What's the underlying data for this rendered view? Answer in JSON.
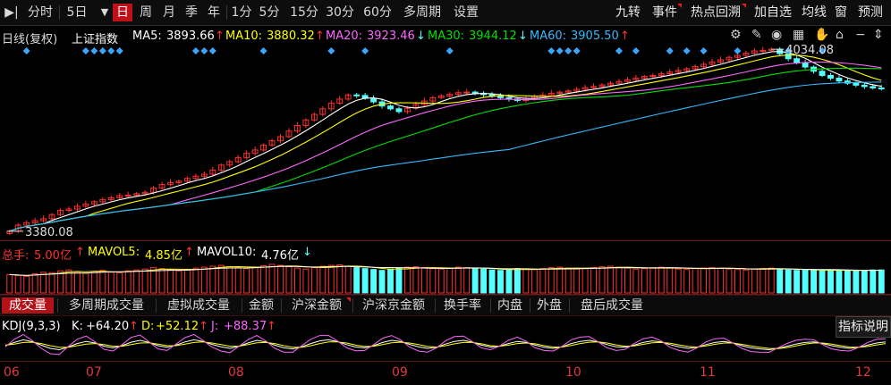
{
  "toolbar": {
    "left_icon": "▶︎|",
    "periods": [
      "分时",
      "5日",
      "日",
      "周",
      "月",
      "季",
      "年",
      "1分",
      "5分",
      "15分",
      "30分",
      "60分",
      "多周期",
      "设置"
    ],
    "active_period": "日",
    "dropdown_icon": "▼",
    "right": [
      "九转",
      "事件",
      "热点回溯",
      "加自选",
      "均线",
      "窗",
      "预测"
    ]
  },
  "legend": {
    "line_type": "日线(复权)",
    "index_name": "上证指数",
    "ma5_label": "MA5:",
    "ma5": "3893.66",
    "ma5_arrow": "↑",
    "ma10_label": "MA10:",
    "ma10": "3880.32",
    "ma10_arrow": "↑",
    "ma20_label": "MA20:",
    "ma20": "3923.46",
    "ma20_arrow": "↓",
    "ma30_label": "MA30:",
    "ma30": "3944.12",
    "ma30_arrow": "↓",
    "ma60_label": "MA60:",
    "ma60": "3905.50",
    "ma60_arrow": "↑"
  },
  "price_labels": {
    "high": "4034.08",
    "low": "3380.08"
  },
  "volume": {
    "total_label": "总手:",
    "total": "5.00亿",
    "total_arrow": "↑",
    "mavol5_label": "MAVOL5:",
    "mavol5": "4.85亿",
    "mavol5_arrow": "↑",
    "mavol10_label": "MAVOL10:",
    "mavol10": "4.76亿",
    "mavol10_arrow": "↓"
  },
  "indicator_tabs": [
    "成交量",
    "多周期成交量",
    "虚拟成交量",
    "金额",
    "沪深金额",
    "沪深京金额",
    "换手率",
    "内盘",
    "外盘",
    "盘后成交量"
  ],
  "active_tab": "成交量",
  "kdj": {
    "name": "KDJ(9,3,3)",
    "k_label": "K:",
    "k": "+64.20",
    "k_arrow": "↑",
    "d_label": "D:",
    "d": "+52.12",
    "d_arrow": "↑",
    "j_label": "J:",
    "j": "+88.37",
    "j_arrow": "↑"
  },
  "explain_button": "指标说明",
  "months": [
    "06",
    "07",
    "08",
    "09",
    "10",
    "11",
    "12"
  ],
  "colors": {
    "up": "#ff3030",
    "down": "#54ffff",
    "ma5": "#ffffff",
    "ma10": "#ffff00",
    "ma20": "#ff66ff",
    "ma30": "#00e000",
    "ma60": "#33bbff",
    "diamond": "#3aa6ff"
  },
  "chart_data": {
    "type": "candlestick",
    "y_range": [
      3380.08,
      4034.08
    ],
    "close": [
      3380,
      3402,
      3410,
      3418,
      3425,
      3440,
      3455,
      3460,
      3470,
      3478,
      3486,
      3494,
      3500,
      3508,
      3510,
      3515,
      3520,
      3535,
      3548,
      3555,
      3560,
      3570,
      3578,
      3585,
      3600,
      3618,
      3630,
      3645,
      3660,
      3672,
      3690,
      3705,
      3720,
      3740,
      3760,
      3780,
      3800,
      3820,
      3840,
      3855,
      3870,
      3868,
      3858,
      3845,
      3830,
      3820,
      3810,
      3822,
      3835,
      3848,
      3860,
      3866,
      3872,
      3878,
      3880,
      3876,
      3871,
      3865,
      3860,
      3855,
      3850,
      3858,
      3864,
      3870,
      3876,
      3880,
      3884,
      3890,
      3896,
      3900,
      3906,
      3912,
      3918,
      3924,
      3930,
      3936,
      3940,
      3946,
      3952,
      3958,
      3964,
      3972,
      3980,
      3988,
      3996,
      4005,
      4012,
      4020,
      4028,
      4030,
      4034,
      4018,
      4000,
      3985,
      3970,
      3955,
      3940,
      3930,
      3920,
      3912,
      3905,
      3900,
      3895,
      3893
    ],
    "volume": [
      40,
      38,
      36,
      42,
      45,
      44,
      48,
      50,
      46,
      43,
      47,
      49,
      45,
      44,
      48,
      50,
      52,
      55,
      53,
      50,
      48,
      51,
      54,
      56,
      58,
      60,
      57,
      55,
      53,
      56,
      59,
      62,
      60,
      57,
      54,
      52,
      55,
      58,
      60,
      61,
      58,
      55,
      53,
      51,
      49,
      52,
      54,
      56,
      57,
      55,
      53,
      52,
      54,
      56,
      55,
      53,
      52,
      50,
      49,
      51,
      53,
      52,
      51,
      53,
      55,
      56,
      54,
      52,
      53,
      55,
      57,
      58,
      56,
      54,
      52,
      53,
      55,
      56,
      54,
      52,
      51,
      53,
      54,
      55,
      54,
      52,
      51,
      50,
      52,
      53,
      54,
      52,
      50,
      49,
      51,
      50,
      48,
      49,
      50,
      49,
      48,
      49,
      50,
      50
    ],
    "kdj_k": [
      50,
      62,
      72,
      65,
      52,
      40,
      35,
      45,
      58,
      66,
      60,
      48,
      42,
      50,
      63,
      70,
      62,
      50,
      44,
      52,
      64,
      72,
      66,
      55,
      46,
      40,
      48,
      60,
      70,
      64,
      52,
      42,
      38,
      46,
      58,
      68,
      72,
      65,
      54,
      45,
      42,
      50,
      62,
      70,
      66,
      55,
      46,
      40,
      44,
      56,
      66,
      70,
      63,
      52,
      45,
      48,
      58,
      66,
      62,
      52,
      44,
      40,
      46,
      58,
      66,
      70,
      64,
      54,
      46,
      44,
      52,
      62,
      68,
      64,
      54,
      46,
      40,
      44,
      54,
      62,
      66,
      60,
      50,
      42,
      38,
      35,
      40,
      48,
      56,
      62,
      64,
      58,
      50,
      44,
      40,
      44,
      52,
      60,
      64
    ],
    "kdj_d": [
      52,
      56,
      62,
      63,
      58,
      50,
      44,
      44,
      50,
      56,
      58,
      54,
      48,
      48,
      54,
      60,
      61,
      56,
      50,
      50,
      56,
      62,
      64,
      60,
      54,
      48,
      48,
      54,
      61,
      62,
      58,
      50,
      44,
      44,
      50,
      58,
      64,
      64,
      60,
      52,
      47,
      48,
      54,
      61,
      63,
      60,
      54,
      47,
      45,
      50,
      57,
      62,
      62,
      57,
      50,
      48,
      52,
      58,
      60,
      57,
      50,
      45,
      45,
      51,
      58,
      63,
      64,
      60,
      53,
      48,
      49,
      55,
      61,
      62,
      59,
      53,
      47,
      45,
      49,
      55,
      60,
      60,
      55,
      49,
      44,
      40,
      39,
      43,
      49,
      56,
      60,
      60,
      56,
      50,
      45,
      44,
      47,
      53,
      58
    ],
    "kdj_j": [
      46,
      74,
      92,
      69,
      40,
      20,
      17,
      47,
      74,
      86,
      64,
      36,
      30,
      54,
      81,
      90,
      64,
      38,
      32,
      56,
      80,
      92,
      70,
      45,
      30,
      24,
      48,
      72,
      88,
      68,
      40,
      26,
      26,
      50,
      74,
      88,
      88,
      67,
      42,
      31,
      32,
      54,
      78,
      88,
      72,
      45,
      30,
      26,
      42,
      68,
      84,
      86,
      65,
      42,
      35,
      48,
      70,
      82,
      66,
      42,
      32,
      30,
      48,
      72,
      82,
      84,
      64,
      42,
      32,
      36,
      58,
      76,
      82,
      68,
      44,
      32,
      26,
      42,
      64,
      76,
      78,
      60,
      40,
      28,
      26,
      25,
      42,
      58,
      70,
      74,
      72,
      54,
      38,
      32,
      30,
      44,
      62,
      74,
      76
    ]
  }
}
